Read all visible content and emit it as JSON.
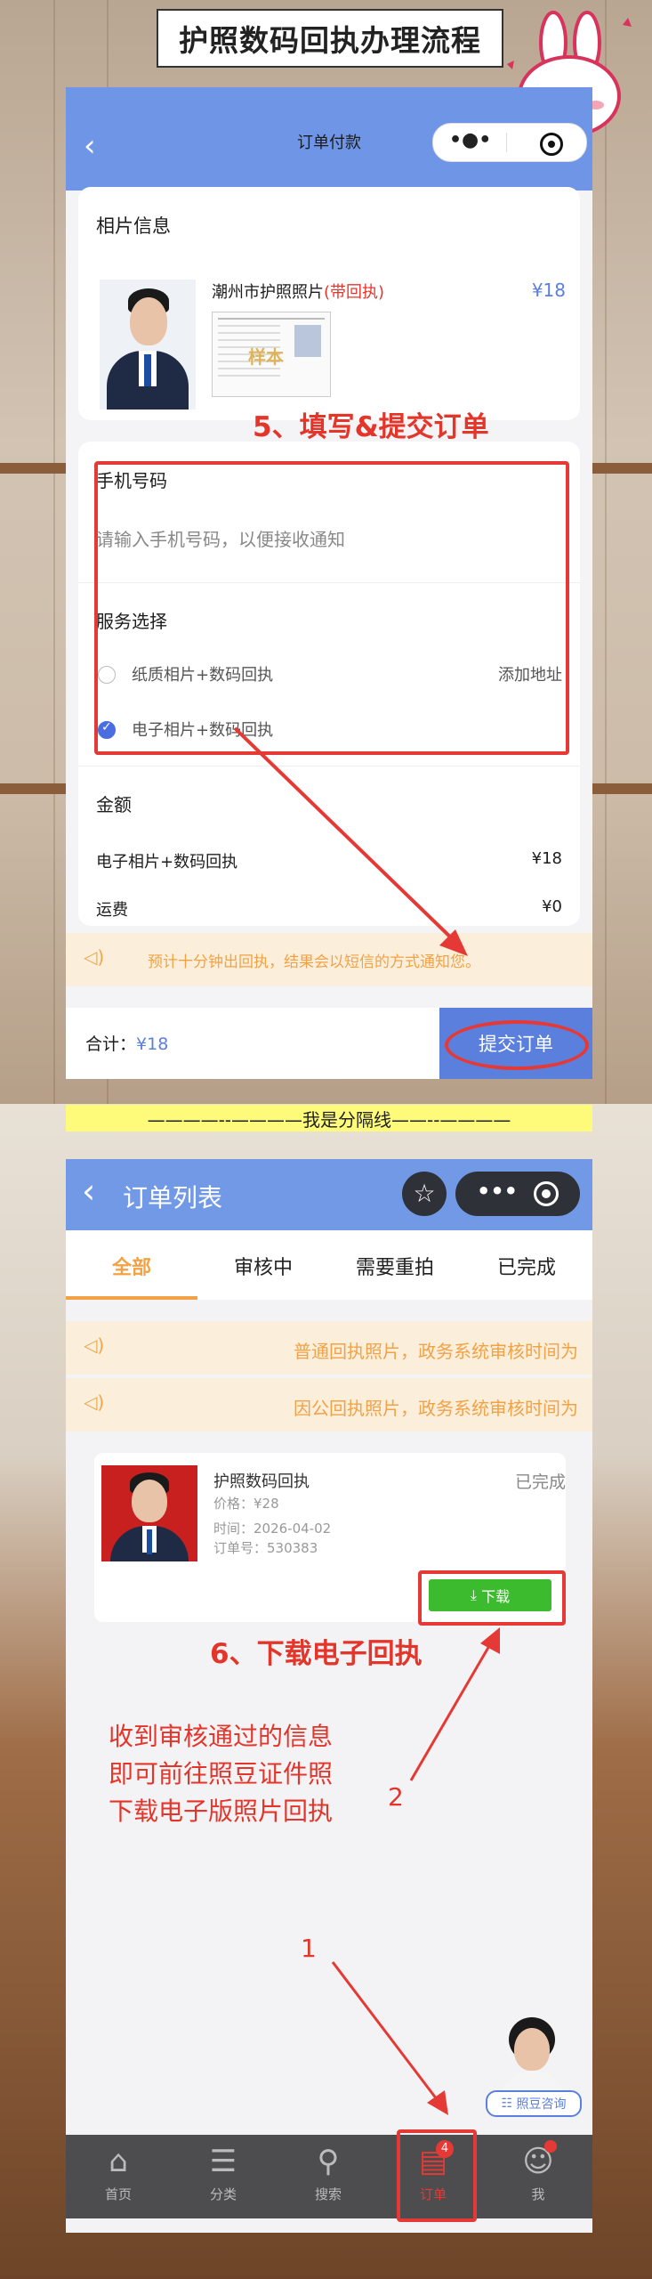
{
  "banner": {
    "title": "护照数码回执办理流程"
  },
  "screen1": {
    "nav_title": "订单付款",
    "section_photo": "相片信息",
    "product_name": "潮州市护照照片",
    "product_tag": "(带回执)",
    "product_price": "¥18",
    "receipt_stamp": "样本",
    "step5": "5、填写&提交订单",
    "phone_label": "手机号码",
    "phone_placeholder": "请输入手机号码，以便接收通知",
    "service_label": "服务选择",
    "option1": "纸质相片+数码回执",
    "option1_action": "添加地址",
    "option2": "电子相片+数码回执",
    "amount_label": "金额",
    "line1_label": "电子相片+数码回执",
    "line1_value": "¥18",
    "freight_label": "运费",
    "freight_value": "¥0",
    "notice": "预计十分钟出回执，结果会以短信的方式通知您。",
    "total_label": "合计：",
    "total_value": "¥18",
    "submit": "提交订单"
  },
  "divider": "————--————我是分隔线——--————",
  "screen2": {
    "nav_title": "订单列表",
    "tabs": [
      "全部",
      "审核中",
      "需要重拍",
      "已完成"
    ],
    "notice1": "普通回执照片，政务系统审核时间为",
    "notice2": "因公回执照片，政务系统审核时间为",
    "order": {
      "name": "护照数码回执",
      "status": "已完成",
      "price": "价格：¥28",
      "time": "时间：2026-04-02",
      "order_no": "订单号：530383",
      "download": "下载"
    },
    "step6": "6、下载电子回执",
    "instruction_lines": [
      "收到审核通过的信息",
      "即可前往照豆证件照",
      "下载电子版照片回执"
    ],
    "num1": "1",
    "num2": "2",
    "consult": "照豆咨询",
    "tabbar": [
      {
        "label": "首页",
        "icon": "home-icon"
      },
      {
        "label": "分类",
        "icon": "list-icon"
      },
      {
        "label": "搜索",
        "icon": "search-icon"
      },
      {
        "label": "订单",
        "icon": "order-icon",
        "badge": "4"
      },
      {
        "label": "我",
        "icon": "user-icon"
      }
    ]
  },
  "colors": {
    "accent_blue": "#6f95e6",
    "orange": "#f2a245",
    "red": "#e53935",
    "green": "#3dbb2f"
  }
}
